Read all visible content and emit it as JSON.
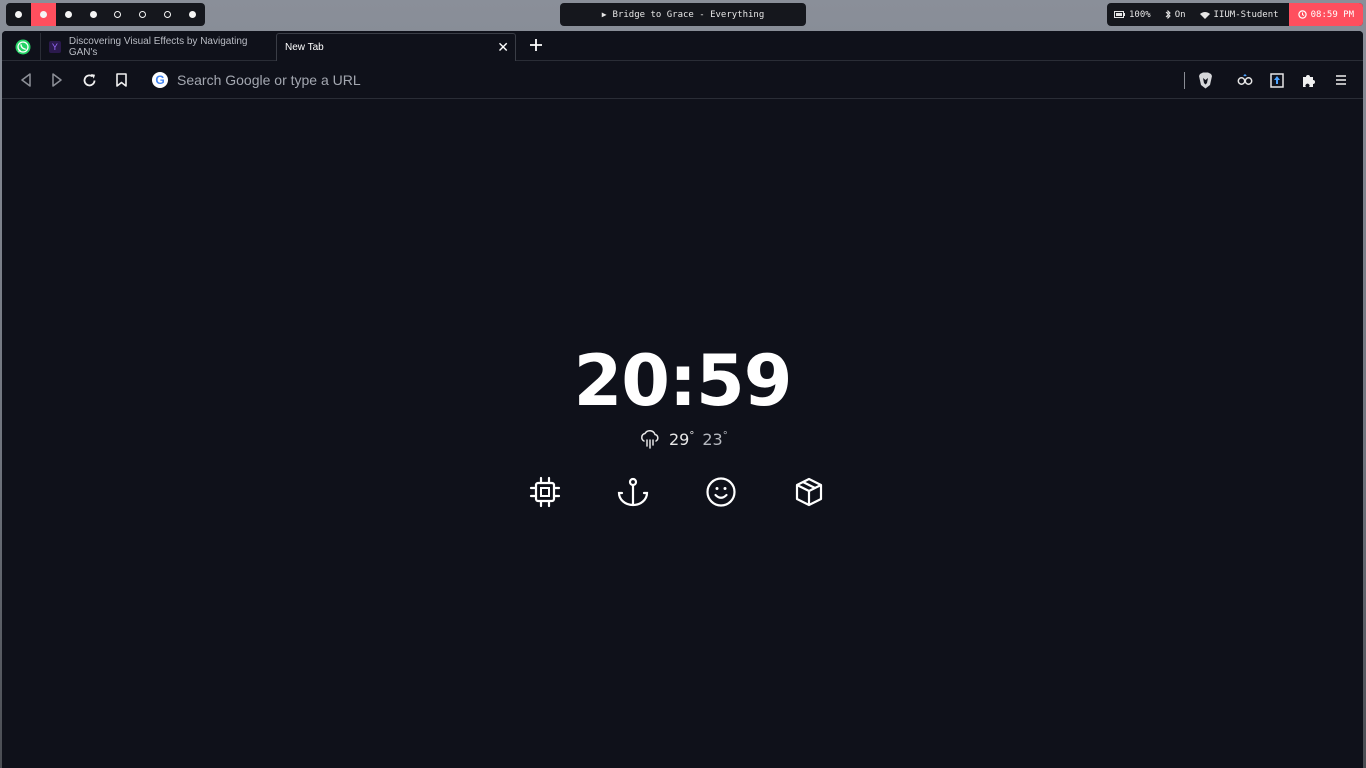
{
  "topbar": {
    "workspaces": [
      {
        "state": "filled",
        "active": false
      },
      {
        "state": "filled",
        "active": true
      },
      {
        "state": "filled",
        "active": false
      },
      {
        "state": "filled",
        "active": false
      },
      {
        "state": "empty",
        "active": false
      },
      {
        "state": "empty",
        "active": false
      },
      {
        "state": "empty",
        "active": false
      },
      {
        "state": "filled",
        "active": false
      }
    ],
    "media": {
      "icon": "play-icon",
      "title": "Bridge to Grace - Everything"
    },
    "battery": {
      "icon": "battery-icon",
      "label": "100%"
    },
    "bluetooth": {
      "icon": "bluetooth-icon",
      "label": "On"
    },
    "wifi": {
      "icon": "wifi-icon",
      "label": "IIUM-Student"
    },
    "clock": {
      "icon": "clock-icon",
      "label": "08:59 PM"
    },
    "colors": {
      "accent": "#ff4f5e",
      "pill_bg": "#15171d"
    }
  },
  "browser": {
    "tabs": [
      {
        "icon": "whatsapp-icon",
        "title": ""
      },
      {
        "icon": "gan-favicon",
        "title": "Discovering Visual Effects by Navigating GAN's"
      },
      {
        "icon": "",
        "title": "New Tab",
        "active": true
      }
    ],
    "toolbar": {
      "omnibox_placeholder": "Search Google or type a URL",
      "buttons": [
        "back-icon",
        "forward-icon",
        "reload-icon",
        "bookmark-icon",
        "brave-shield-icon",
        "extension-1-icon",
        "extension-2-icon",
        "puzzle-icon",
        "menu-icon"
      ]
    },
    "colors": {
      "background": "#0f111a"
    }
  },
  "newtab": {
    "time": "20:59",
    "weather": {
      "icon": "rain-cloud-icon",
      "high": "29",
      "low": "23",
      "degree": "°"
    },
    "shortcuts": [
      "cpu-icon",
      "anchor-icon",
      "smiley-icon",
      "package-icon"
    ]
  }
}
